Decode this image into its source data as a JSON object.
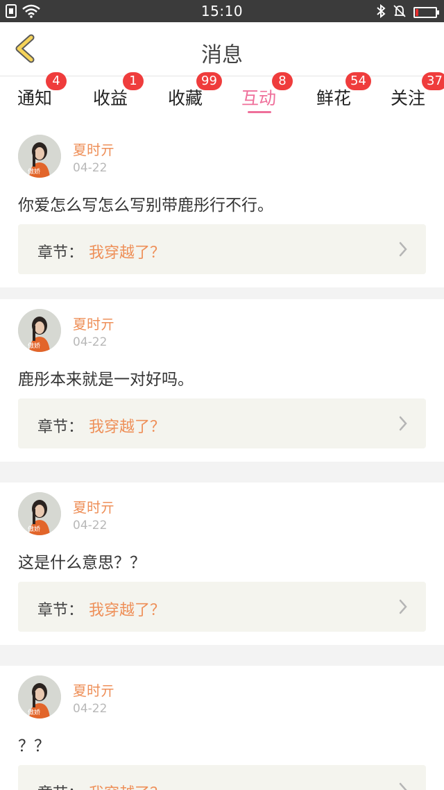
{
  "status_bar": {
    "time": "15:10",
    "battery_level": 0.15
  },
  "header": {
    "title": "消息"
  },
  "tabs": [
    {
      "label": "通知",
      "badge": "4"
    },
    {
      "label": "收益",
      "badge": "1"
    },
    {
      "label": "收藏",
      "badge": "99"
    },
    {
      "label": "互动",
      "badge": "8",
      "active": true
    },
    {
      "label": "鲜花",
      "badge": "54"
    },
    {
      "label": "关注",
      "badge": "37"
    }
  ],
  "messages": [
    {
      "name": "夏时亓",
      "date": "04-22",
      "content": "你爱怎么写怎么写别带鹿彤行不行。",
      "chapter_label": "章节：",
      "chapter_title": "我穿越了？"
    },
    {
      "name": "夏时亓",
      "date": "04-22",
      "content": "鹿彤本来就是一对好吗。",
      "chapter_label": "章节：",
      "chapter_title": "我穿越了？"
    },
    {
      "name": "夏时亓",
      "date": "04-22",
      "content": "这是什么意思？？",
      "chapter_label": "章节：",
      "chapter_title": "我穿越了？"
    },
    {
      "name": "夏时亓",
      "date": "04-22",
      "content": "？？",
      "chapter_label": "章节：",
      "chapter_title": "我穿越了？"
    }
  ],
  "colors": {
    "accent_pink": "#ef6f9a",
    "accent_orange": "#ee8f58",
    "badge_red": "#ef3c3c"
  }
}
